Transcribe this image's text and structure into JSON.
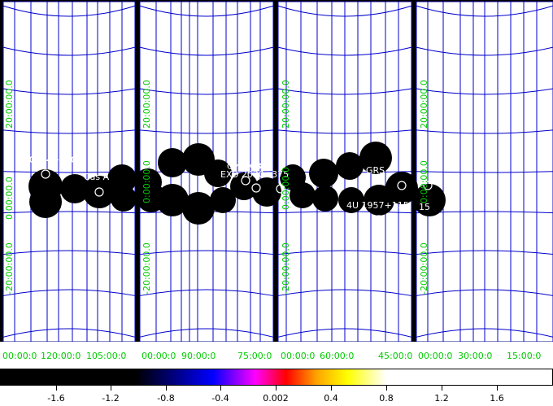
{
  "sources": [
    {
      "label": "0114+650"
    },
    {
      "label": "Cas A"
    },
    {
      "label": "Cyg X-3"
    },
    {
      "label": "EXO 2030+375"
    },
    {
      "label": "GRS"
    },
    {
      "label": "4U 1957+115"
    },
    {
      "label": "15"
    }
  ],
  "ra_labels": [
    "00:00:0",
    "120:00:0",
    "105:00:0",
    "00:00:0",
    "90:00:0",
    "75:00:0",
    "00:00:0",
    "60:00:0",
    "45:00:0",
    "00:00:0",
    "30:00:0",
    "15:00:0"
  ],
  "dec_labels": [
    "20:00:00.0",
    "0:00:00.0",
    "-20:00:00.0"
  ],
  "colorbar": {
    "tick_labels": [
      "-1.6",
      "-1.2",
      "-0.8",
      "-0.4",
      "0.002",
      "0.4",
      "0.8",
      "1.2",
      "1.6"
    ]
  },
  "colors": {
    "background": "#000000",
    "grid": "#0000cc",
    "axis_labels": "#00cc00",
    "source_labels": "#ffffff"
  }
}
